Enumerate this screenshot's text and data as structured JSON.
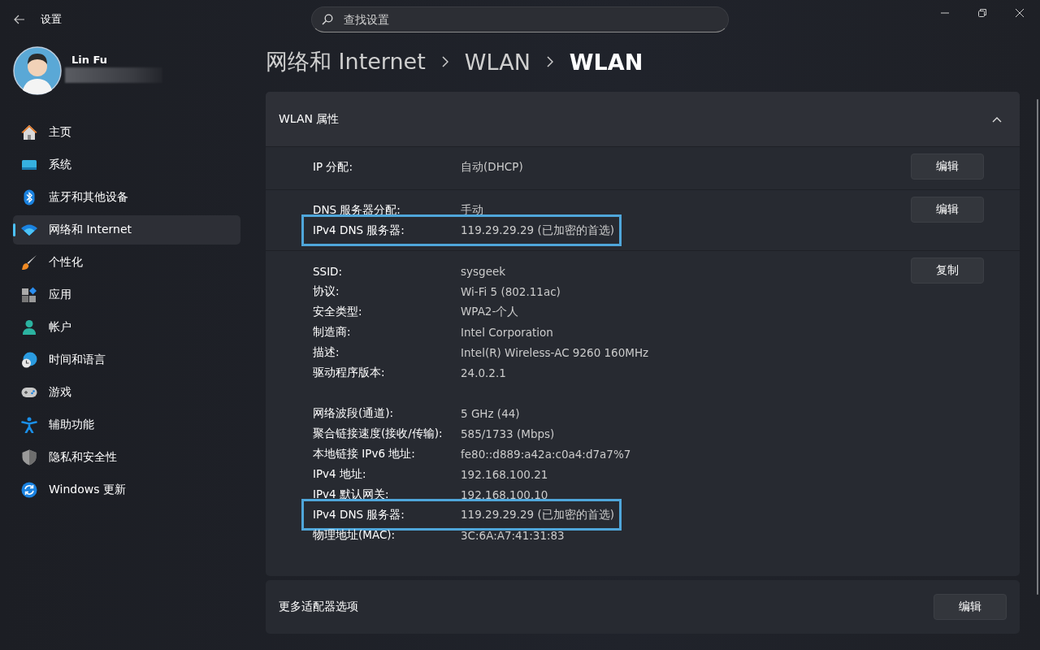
{
  "window": {
    "title": "设置"
  },
  "search": {
    "placeholder": "查找设置"
  },
  "profile": {
    "name": "Lin Fu"
  },
  "sidebar": {
    "items": [
      {
        "label": "主页",
        "selected": false
      },
      {
        "label": "系统",
        "selected": false
      },
      {
        "label": "蓝牙和其他设备",
        "selected": false
      },
      {
        "label": "网络和 Internet",
        "selected": true
      },
      {
        "label": "个性化",
        "selected": false
      },
      {
        "label": "应用",
        "selected": false
      },
      {
        "label": "帐户",
        "selected": false
      },
      {
        "label": "时间和语言",
        "selected": false
      },
      {
        "label": "游戏",
        "selected": false
      },
      {
        "label": "辅助功能",
        "selected": false
      },
      {
        "label": "隐私和安全性",
        "selected": false
      },
      {
        "label": "Windows 更新",
        "selected": false
      }
    ]
  },
  "breadcrumb": [
    "网络和 Internet",
    "WLAN",
    "WLAN"
  ],
  "properties": {
    "title": "WLAN 属性",
    "expanded": true,
    "sections": [
      {
        "button": "编辑",
        "groups": [
          {
            "rows": [
              {
                "label": "IP 分配:",
                "value": "自动(DHCP)",
                "highlighted": false
              }
            ]
          }
        ]
      },
      {
        "button": "编辑",
        "groups": [
          {
            "rows": [
              {
                "label": "DNS 服务器分配:",
                "value": "手动",
                "highlighted": false
              },
              {
                "label": "IPv4 DNS 服务器:",
                "value": "119.29.29.29 (已加密的首选)",
                "highlighted": true
              }
            ]
          }
        ]
      },
      {
        "button": "复制",
        "groups": [
          {
            "rows": [
              {
                "label": "SSID:",
                "value": "sysgeek",
                "highlighted": false
              },
              {
                "label": "协议:",
                "value": "Wi-Fi 5 (802.11ac)",
                "highlighted": false
              },
              {
                "label": "安全类型:",
                "value": "WPA2-个人",
                "highlighted": false
              },
              {
                "label": "制造商:",
                "value": "Intel Corporation",
                "highlighted": false
              },
              {
                "label": "描述:",
                "value": "Intel(R) Wireless-AC 9260 160MHz",
                "highlighted": false
              },
              {
                "label": "驱动程序版本:",
                "value": "24.0.2.1",
                "highlighted": false
              }
            ]
          },
          {
            "rows": [
              {
                "label": "网络波段(通道):",
                "value": "5 GHz (44)",
                "highlighted": false
              },
              {
                "label": "聚合链接速度(接收/传输):",
                "value": "585/1733 (Mbps)",
                "highlighted": false
              },
              {
                "label": "本地链接 IPv6 地址:",
                "value": "fe80::d889:a42a:c0a4:d7a7%7",
                "highlighted": false
              },
              {
                "label": "IPv4 地址:",
                "value": "192.168.100.21",
                "highlighted": false
              },
              {
                "label": "IPv4 默认网关:",
                "value": "192.168.100.10",
                "highlighted": false
              },
              {
                "label": "IPv4 DNS 服务器:",
                "value": "119.29.29.29 (已加密的首选)",
                "highlighted": true
              },
              {
                "label": "物理地址(MAC):",
                "value": "3C:6A:A7:41:31:83",
                "highlighted": false
              }
            ]
          }
        ]
      }
    ]
  },
  "more_options": {
    "label": "更多适配器选项",
    "button": "编辑"
  }
}
